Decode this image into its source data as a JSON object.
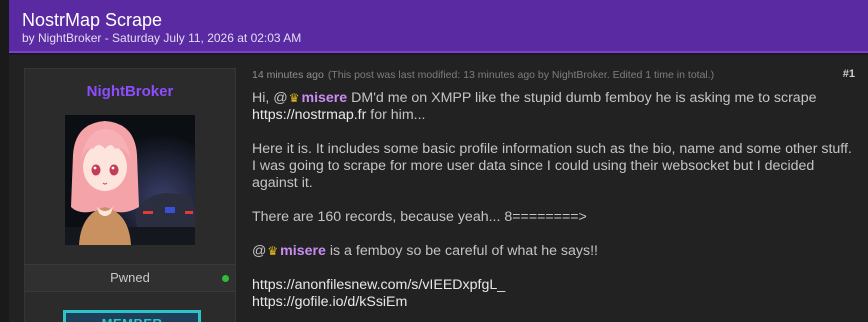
{
  "header": {
    "title": "NostrMap Scrape",
    "meta": "by NightBroker - Saturday July 11, 2026 at 02:03 AM"
  },
  "author": {
    "name": "NightBroker",
    "status": "Pwned",
    "rank": "MEMBER"
  },
  "post": {
    "time": "14 minutes ago",
    "edit_note": "(This post was last modified: 13 minutes ago by NightBroker. Edited 1 time in total.)",
    "number": "#1",
    "p1_prefix": "Hi, @",
    "mention1": "misere",
    "p1_rest": " DM'd me on XMPP like the stupid dumb femboy he is asking me to scrape",
    "link1": "https://nostrmap.fr",
    "p1_end": " for him...",
    "p2": "Here it is. It includes some basic profile information such as the bio, name and some other stuff. I was going to scrape for more user data since I could using their websocket but I decided against it.",
    "p3": "There are 160 records, because yeah... 8========>",
    "p4_prefix": "@",
    "mention2": "misere",
    "p4_rest": " is a femboy so be careful of what he says!!",
    "download1": "https://anonfilesnew.com/s/vIEEDxpfgL_",
    "download2": "https://gofile.io/d/kSsiEm"
  },
  "colors": {
    "header_bg": "#5a2aa3",
    "author_name": "#8d4dff",
    "mention": "#c98cf2",
    "crown": "#e6b81a",
    "online": "#2ebd3a",
    "rank_badge": "#2bc4c9"
  },
  "icons": {
    "mention_prefix": "crown-icon",
    "status_indicator": "online-dot-icon"
  }
}
